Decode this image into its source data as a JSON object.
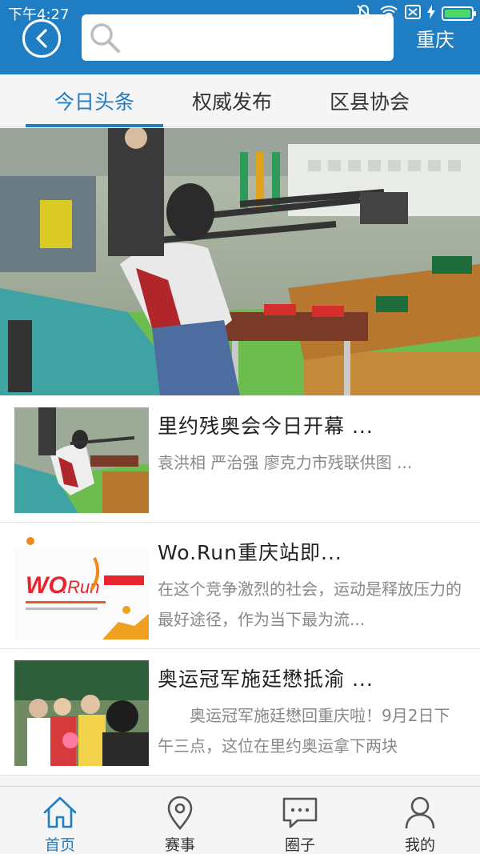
{
  "status_bar": {
    "time": "下午4:27"
  },
  "header": {
    "search_placeholder": "",
    "city": "重庆"
  },
  "tabs": [
    {
      "label": "今日头条",
      "active": true
    },
    {
      "label": "权威发布",
      "active": false
    },
    {
      "label": "区县协会",
      "active": false
    }
  ],
  "news": [
    {
      "title": "里约残奥会今日开幕 ...",
      "summary": "袁洪相 严治强 廖克力市残联供图 ..."
    },
    {
      "title": "Wo.Run重庆站即...",
      "summary": "在这个竞争激烈的社会，运动是释放压力的最好途径，作为当下最为流..."
    },
    {
      "title": "奥运冠军施廷懋抵渝 ...",
      "summary": "　　奥运冠军施廷懋回重庆啦！9月2日下午三点，这位在里约奥运拿下两块"
    }
  ],
  "bottom_nav": [
    {
      "label": "首页",
      "icon": "home-icon",
      "active": true
    },
    {
      "label": "赛事",
      "icon": "location-pin-icon",
      "active": false
    },
    {
      "label": "圈子",
      "icon": "chat-bubble-icon",
      "active": false
    },
    {
      "label": "我的",
      "icon": "user-icon",
      "active": false
    }
  ],
  "colors": {
    "primary": "#1f7dc4",
    "battery": "#4cd964"
  }
}
